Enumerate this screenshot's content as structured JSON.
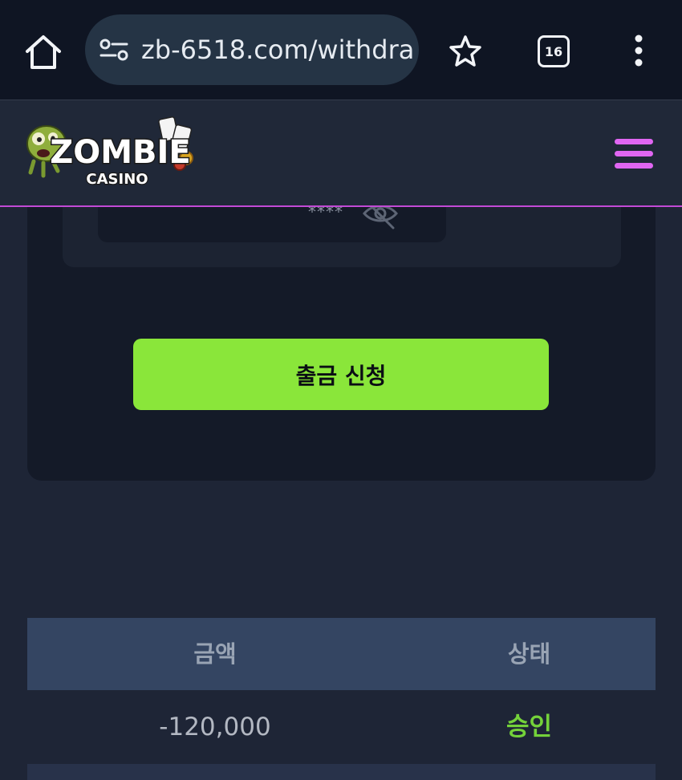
{
  "browser": {
    "url": "zb-6518.com/withdra",
    "tab_count": "16"
  },
  "site": {
    "logo_text": "ZOMBIE",
    "logo_subtext": "CASINO"
  },
  "form": {
    "password_mask": "****",
    "submit_label": "출금 신청"
  },
  "table": {
    "headers": [
      "금액",
      "상태"
    ],
    "rows": [
      {
        "amount": "-120,000",
        "status": "승인"
      }
    ]
  },
  "colors": {
    "accent_green": "#8ae63a",
    "accent_purple": "#e066f2",
    "status_approved": "#74d23a"
  }
}
